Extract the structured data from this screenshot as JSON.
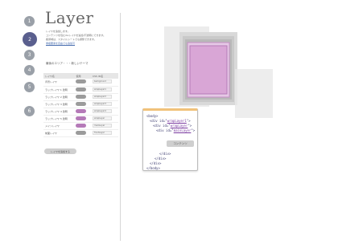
{
  "app": {
    "title": "Layer"
  },
  "steps": [
    {
      "label": "1",
      "active": false
    },
    {
      "label": "2",
      "active": true
    },
    {
      "label": "3",
      "active": false
    },
    {
      "label": "4",
      "active": false
    },
    {
      "label": "5",
      "active": false
    },
    {
      "label": "6",
      "active": false
    }
  ],
  "description": {
    "line1": "レイヤを追加します。",
    "line2": "コンテンツを包むdivレイヤを追加/不透明にできます。",
    "line3": "各領域は、スタイルシートでも調整できます。",
    "link": "重複要素を自由でも追加可"
  },
  "section_label": "最後のエリア・・・新しいテーマ",
  "table": {
    "headers": [
      "レイヤ名",
      "使用",
      "CSS ID名"
    ],
    "rows": [
      {
        "name": "背景レイヤ",
        "on": false,
        "id": "background"
      },
      {
        "name": "ラップレイヤ 1 透明",
        "on": false,
        "id": "wrapLayer1"
      },
      {
        "name": "ラップレイヤ 2 透明",
        "on": false,
        "id": "wrapLayer2"
      },
      {
        "name": "ラップレイヤ 3 透明",
        "on": false,
        "id": "wrapLayer3"
      },
      {
        "name": "ラップレイヤ 4 透明",
        "on": true,
        "id": "wrapLayer4"
      },
      {
        "name": "ラップレイヤ 5 透明",
        "on": true,
        "id": "wrapLayer"
      },
      {
        "name": "メインレイヤ",
        "on": true,
        "id": "mainLayer"
      },
      {
        "name": "前面レイヤ",
        "on": false,
        "id": "frontLayer"
      }
    ]
  },
  "add_button": "レイヤを追加する",
  "code": {
    "l1": "<body>",
    "l2a": "<div id=\"",
    "l2b": "wrapLayer1",
    "l2c": "\">",
    "l3a": "<div id=\"",
    "l3b": "wrapLayer",
    "l3c": "\">",
    "l4a": "<div id=\"",
    "l4b": "mainLayer",
    "l4c": "\">",
    "content_label": "コンテンツ",
    "c1": "</div>",
    "c2": "</div>",
    "c3": "</div>",
    "c4": "</body>"
  },
  "colors": {
    "accent": "#b57ab8",
    "step_active": "#5a5f8e",
    "step": "#9aa0a8",
    "main_layer": "#d9a6d6"
  }
}
